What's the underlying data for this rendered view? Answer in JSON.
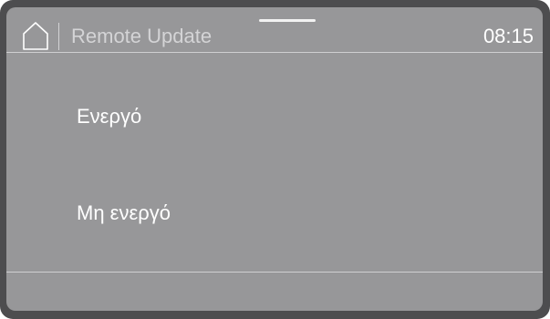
{
  "header": {
    "home_icon": "home-icon",
    "title": "Remote Update",
    "time": "08:15"
  },
  "options": [
    {
      "label": "Ενεργό"
    },
    {
      "label": "Μη ενεργό"
    }
  ],
  "colors": {
    "bezel": "#4d4d4f",
    "screen": "#979799",
    "text": "#ffffff",
    "title_text": "#d4d4d6"
  }
}
